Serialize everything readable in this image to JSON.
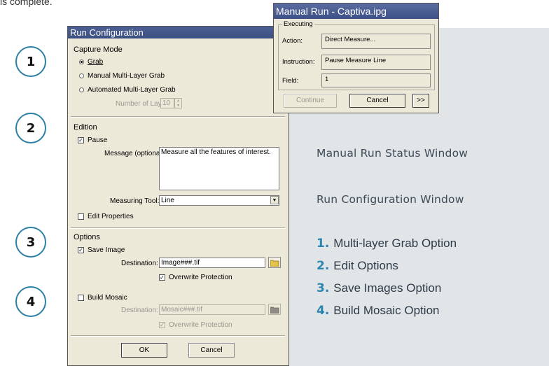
{
  "top_text": "is complete.",
  "numbers": [
    "1",
    "2",
    "3",
    "4"
  ],
  "run_config": {
    "title": "Run Configuration",
    "capture_mode": {
      "heading": "Capture Mode",
      "grab": "Grab",
      "manual_multi": "Manual Multi-Layer Grab",
      "automated_multi": "Automated Multi-Layer Grab",
      "num_layers_label": "Number of Layers:",
      "num_layers_value": "10"
    },
    "edition": {
      "heading": "Edition",
      "pause": "Pause",
      "message_label": "Message (optional):",
      "message_value": "Measure all the features of interest.",
      "tool_label": "Measuring Tool:",
      "tool_value": "Line",
      "edit_props": "Edit Properties"
    },
    "options": {
      "heading": "Options",
      "save_image": "Save Image",
      "dest_label": "Destination:",
      "dest_value": "Image###.tif",
      "overwrite": "Overwrite Protection",
      "build_mosaic": "Build Mosaic",
      "mosaic_dest_label": "Destination:",
      "mosaic_dest_value": "Mosaic###.tif",
      "mosaic_overwrite": "Overwrite Protection"
    },
    "ok": "OK",
    "cancel": "Cancel"
  },
  "manual_run": {
    "title": "Manual Run - Captiva.ipg",
    "group": "Executing",
    "action_label": "Action:",
    "action_value": "Direct Measure...",
    "instruction_label": "Instruction:",
    "instruction_value": "Pause Measure Line",
    "field_label": "Field:",
    "field_value": "1",
    "continue": "Continue",
    "cancel": "Cancel",
    "more": ">>"
  },
  "captions": {
    "status": "Manual Run Status Window",
    "config": "Run Configuration Window"
  },
  "legend": [
    {
      "num": "1.",
      "text": "Multi-layer Grab Option"
    },
    {
      "num": "2.",
      "text": "Edit Options"
    },
    {
      "num": "3.",
      "text": "Save Images Option"
    },
    {
      "num": "4.",
      "text": "Build Mosaic Option"
    }
  ],
  "colors": {
    "accent": "#2a86b0",
    "title_bar": "#3c4f82",
    "panel_bg": "#e2e5e8",
    "dialog_bg": "#ece9d8"
  }
}
